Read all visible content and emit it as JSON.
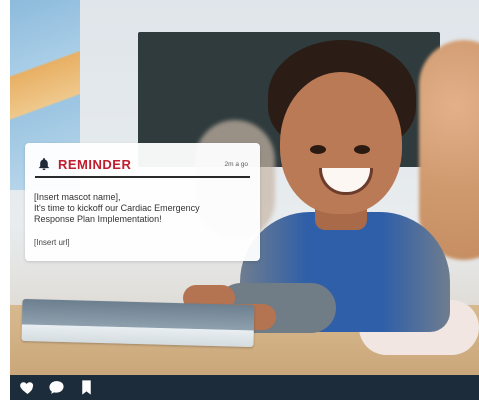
{
  "notification": {
    "icon": "bell-icon",
    "title": "REMINDER",
    "time": "2m a go",
    "body_lines": [
      "[Insert mascot name],",
      "It's time to kickoff our Cardiac Emergency",
      "Response Plan Implementation!"
    ],
    "url": "[Insert url]"
  },
  "bottom_bar": {
    "icons": [
      "heart-icon",
      "comment-icon",
      "bookmark-icon"
    ]
  },
  "colors": {
    "accent": "#c01d2f",
    "bar": "#1d2c3b"
  }
}
